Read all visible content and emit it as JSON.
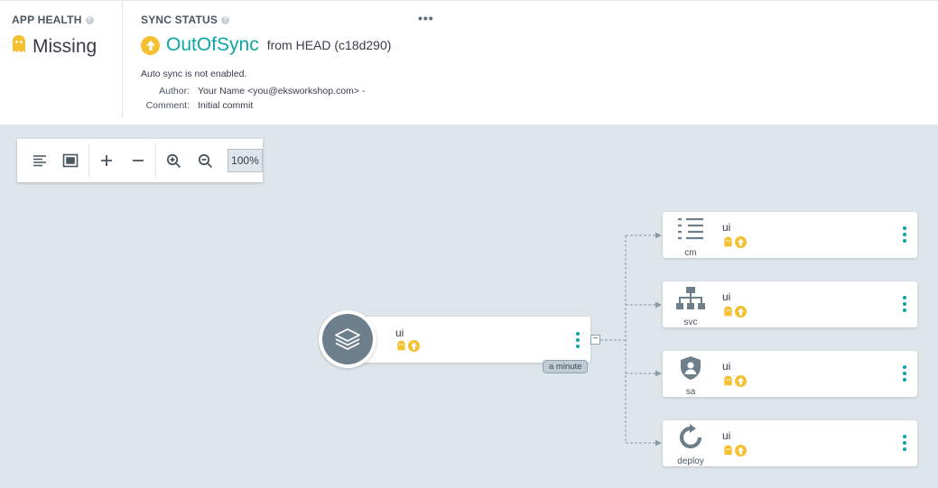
{
  "app_health": {
    "title": "APP HEALTH",
    "value": "Missing",
    "help_icon": "question-circle-icon",
    "status_icon": "ghost-icon",
    "color": "#f4c030"
  },
  "sync_status": {
    "title": "SYNC STATUS",
    "status": "OutOfSync",
    "from": "from HEAD (c18d290)",
    "status_color": "#0ea5a5",
    "status_icon": "arrow-up-circle-icon",
    "more": "•••",
    "auto_sync": "Auto sync is not enabled.",
    "author_label": "Author:",
    "author": "Your Name <you@eksworkshop.com> -",
    "comment_label": "Comment:",
    "comment": "Initial commit"
  },
  "toolbar": {
    "zoom": "100%",
    "buttons": [
      "list-view-icon",
      "fit-to-screen-icon",
      "expand-icon",
      "collapse-icon",
      "zoom-in-icon",
      "zoom-out-icon"
    ]
  },
  "graph": {
    "root": {
      "name": "ui",
      "age": "a minute",
      "icon": "layers-icon",
      "collapse_symbol": "−"
    },
    "children": [
      {
        "name": "ui",
        "kind": "cm",
        "icon": "configmap-icon"
      },
      {
        "name": "ui",
        "kind": "svc",
        "icon": "service-icon"
      },
      {
        "name": "ui",
        "kind": "sa",
        "icon": "service-account-icon"
      },
      {
        "name": "ui",
        "kind": "deploy",
        "icon": "deploy-icon"
      }
    ]
  }
}
